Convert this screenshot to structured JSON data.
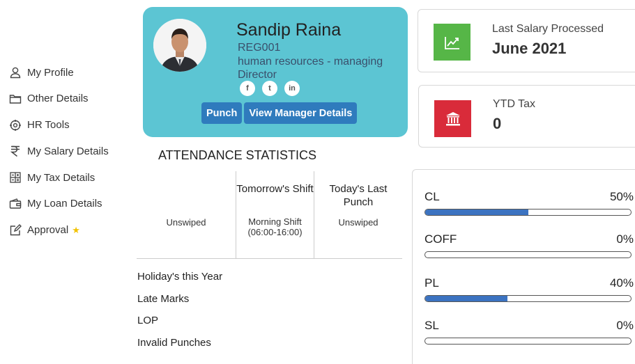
{
  "sidebar": {
    "items": [
      {
        "label": "My Profile",
        "icon": "user-icon"
      },
      {
        "label": "Other Details",
        "icon": "folder-icon"
      },
      {
        "label": "HR Tools",
        "icon": "gear-globe-icon"
      },
      {
        "label": "My Salary Details",
        "icon": "rupee-icon"
      },
      {
        "label": "My Tax Details",
        "icon": "calculator-icon"
      },
      {
        "label": "My Loan Details",
        "icon": "wallet-icon"
      },
      {
        "label": "Approval",
        "icon": "approval-icon",
        "badge": "star-icon"
      }
    ]
  },
  "profile": {
    "name": "Sandip Raina",
    "reg": "REG001",
    "role": "human resources - managing Director",
    "socials": [
      "f",
      "t",
      "in"
    ],
    "punch_label": "Punch",
    "manager_label": "View Manager Details"
  },
  "attendance": {
    "title": "ATTENDANCE STATISTICS",
    "col1": {
      "header": "",
      "value": "Unswiped"
    },
    "col2": {
      "header": "Tomorrow's Shift",
      "value": "Morning Shift (06:00-16:00)"
    },
    "col3": {
      "header": "Today's Last Punch",
      "value": "Unswiped"
    },
    "stats": [
      "Holiday's this Year",
      "Late Marks",
      "LOP",
      "Invalid Punches"
    ]
  },
  "salary_card": {
    "label": "Last Salary Processed",
    "value": "June 2021",
    "color": "#56b647"
  },
  "tax_card": {
    "label": "YTD Tax",
    "value": "0",
    "color": "#d92b3a"
  },
  "leaves": [
    {
      "name": "CL",
      "percent_label": "50%",
      "fraction": 0.5
    },
    {
      "name": "COFF",
      "percent_label": "0%",
      "fraction": 0
    },
    {
      "name": "PL",
      "percent_label": "40%",
      "fraction": 0.4
    },
    {
      "name": "SL",
      "percent_label": "0%",
      "fraction": 0
    }
  ],
  "colors": {
    "card_bg": "#5cc5d3",
    "button": "#2f7bbd",
    "bar_fill": "#3c73c1"
  }
}
